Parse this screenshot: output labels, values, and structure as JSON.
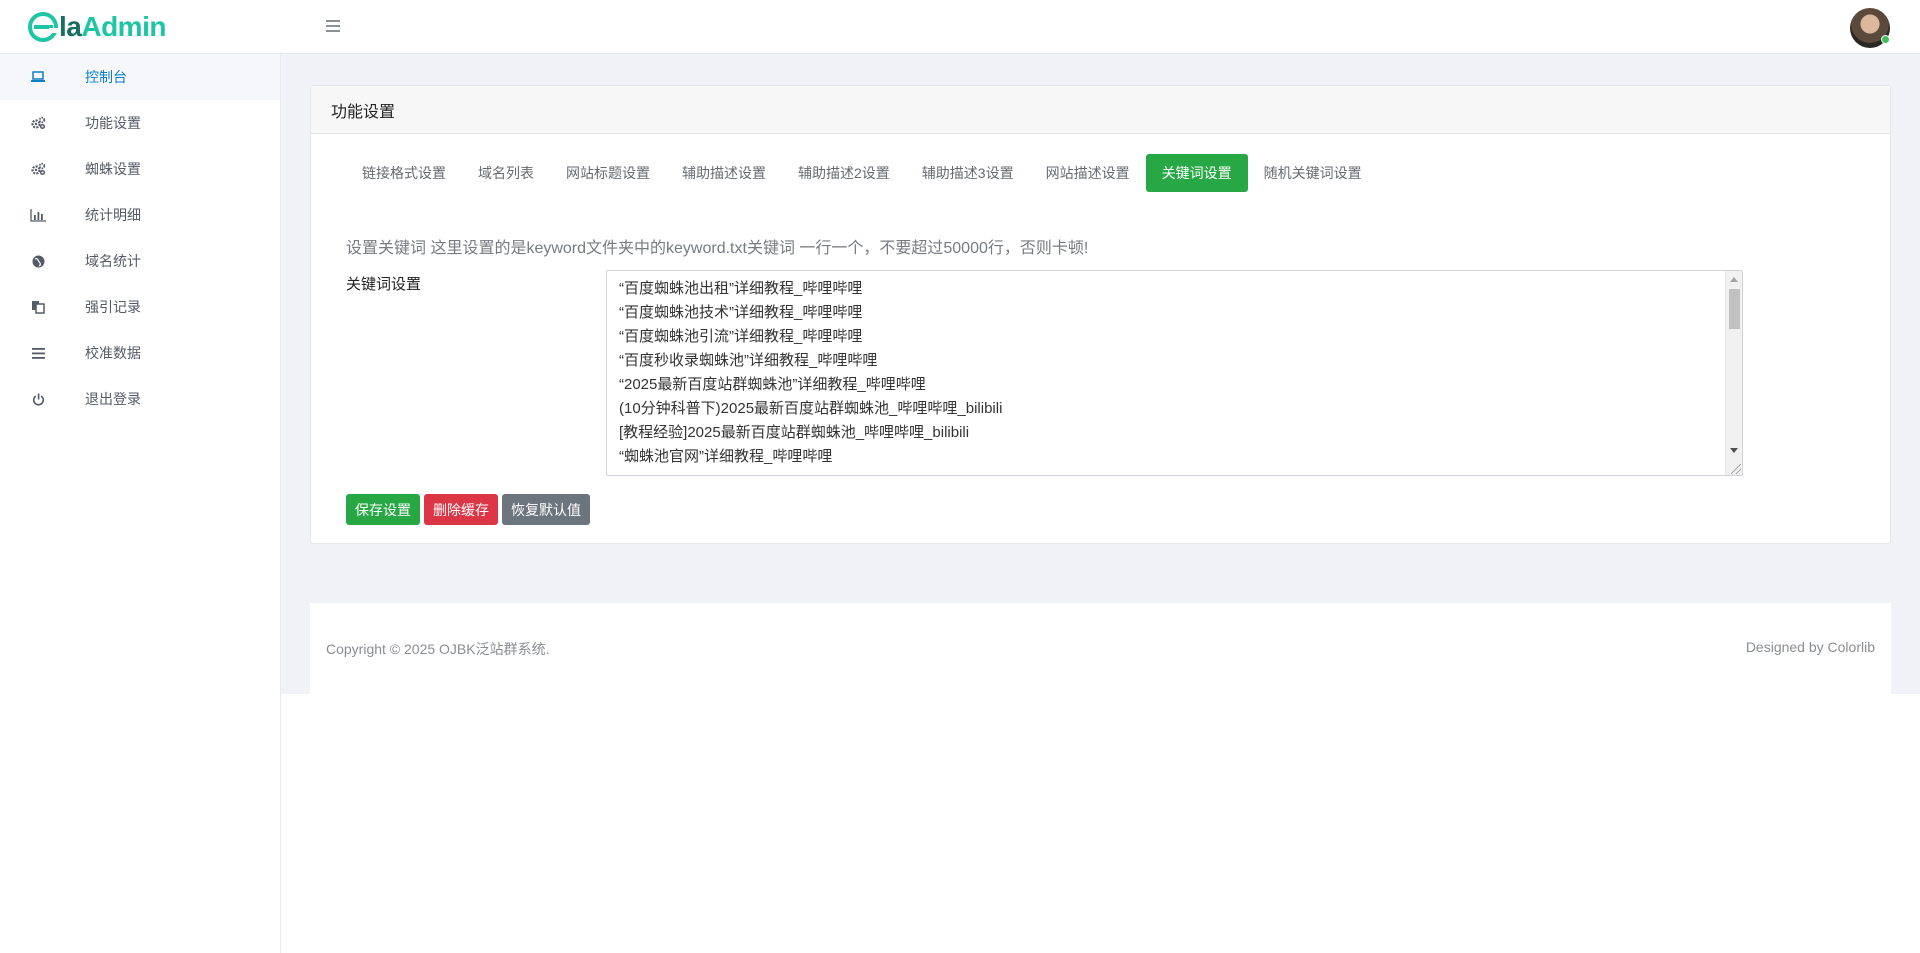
{
  "brand": {
    "name_part1": "la",
    "name_part2": "Admin"
  },
  "sidebar": {
    "items": [
      {
        "label": "控制台",
        "icon": "laptop-icon",
        "active": true
      },
      {
        "label": "功能设置",
        "icon": "gears-icon"
      },
      {
        "label": "蜘蛛设置",
        "icon": "gears-icon"
      },
      {
        "label": "统计明细",
        "icon": "bar-chart-icon"
      },
      {
        "label": "域名统计",
        "icon": "globe-icon"
      },
      {
        "label": "强引记录",
        "icon": "copy-icon"
      },
      {
        "label": "校准数据",
        "icon": "list-icon"
      },
      {
        "label": "退出登录",
        "icon": "power-icon"
      }
    ]
  },
  "card": {
    "title": "功能设置",
    "tabs": [
      {
        "label": "链接格式设置"
      },
      {
        "label": "域名列表"
      },
      {
        "label": "网站标题设置"
      },
      {
        "label": "辅助描述设置"
      },
      {
        "label": "辅助描述2设置"
      },
      {
        "label": "辅助描述3设置"
      },
      {
        "label": "网站描述设置"
      },
      {
        "label": "关键词设置",
        "active": true
      },
      {
        "label": "随机关键词设置"
      }
    ],
    "hint": "设置关键词 这里设置的是keyword文件夹中的keyword.txt关键词 一行一个，不要超过50000行，否则卡顿!",
    "field_label": "关键词设置",
    "keywords": [
      "“百度蜘蛛池出租”详细教程_哔哩哔哩",
      "“百度蜘蛛池技术”详细教程_哔哩哔哩",
      "“百度蜘蛛池引流”详细教程_哔哩哔哩",
      "“百度秒收录蜘蛛池”详细教程_哔哩哔哩",
      "“2025最新百度站群蜘蛛池”详细教程_哔哩哔哩",
      "(10分钟科普下)2025最新百度站群蜘蛛池_哔哩哔哩_bilibili",
      "[教程经验]2025最新百度站群蜘蛛池_哔哩哔哩_bilibili",
      "“蜘蛛池官网”详细教程_哔哩哔哩"
    ],
    "buttons": {
      "save": "保存设置",
      "delete": "删除缓存",
      "restore": "恢复默认值"
    }
  },
  "footer": {
    "copyright": "Copyright © 2025 OJBK泛站群系统.",
    "designed_by": "Designed by Colorlib"
  },
  "colors": {
    "accent": "#1cc5a4",
    "active_link": "#0d7fc4",
    "success": "#28a745",
    "danger": "#dc3545",
    "secondary": "#6c757d"
  }
}
